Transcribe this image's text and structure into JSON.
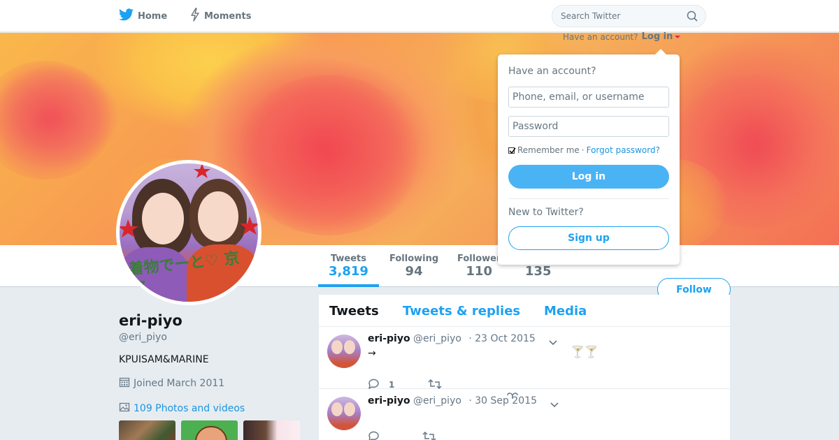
{
  "nav": {
    "home_label": "Home",
    "moments_label": "Moments",
    "search_placeholder": "Search Twitter"
  },
  "login_bar": {
    "prompt": "Have an account?",
    "login_label": "Log in"
  },
  "profile": {
    "name": "eri-piyo",
    "handle": "@eri_piyo",
    "bio": "KPUISAM&MARINE",
    "joined": "Joined March 2011",
    "photos_link": "109 Photos and videos",
    "follow_label": "Follow",
    "avatar_text": "着物でーと♡ 京都"
  },
  "stats": [
    {
      "label": "Tweets",
      "value": "3,819"
    },
    {
      "label": "Following",
      "value": "94"
    },
    {
      "label": "Follower",
      "value": "110"
    },
    {
      "label": "",
      "value": "135"
    }
  ],
  "timeline": {
    "tabs": [
      "Tweets",
      "Tweets & replies",
      "Media"
    ],
    "tweets": [
      {
        "name": "eri-piyo",
        "handle": "@eri_piyo",
        "date": "· 23 Oct 2015",
        "text": "→",
        "emoji": "🍸🍸",
        "replies": "1"
      },
      {
        "name": "eri-piyo",
        "handle": "@eri_piyo",
        "date": "· 30 Sep 2015",
        "text": "",
        "emoji": "",
        "replies": ""
      }
    ]
  },
  "login_dropdown": {
    "heading": "Have an account?",
    "username_placeholder": "Phone, email, or username",
    "password_placeholder": "Password",
    "remember_label": "Remember me",
    "separator": "·",
    "forgot_label": "Forgot password?",
    "login_button": "Log in",
    "new_heading": "New to Twitter?",
    "signup_button": "Sign up"
  },
  "colors": {
    "accent": "#1da1f2",
    "login_button": "#4ab3f4",
    "background": "#e6ecf0"
  }
}
